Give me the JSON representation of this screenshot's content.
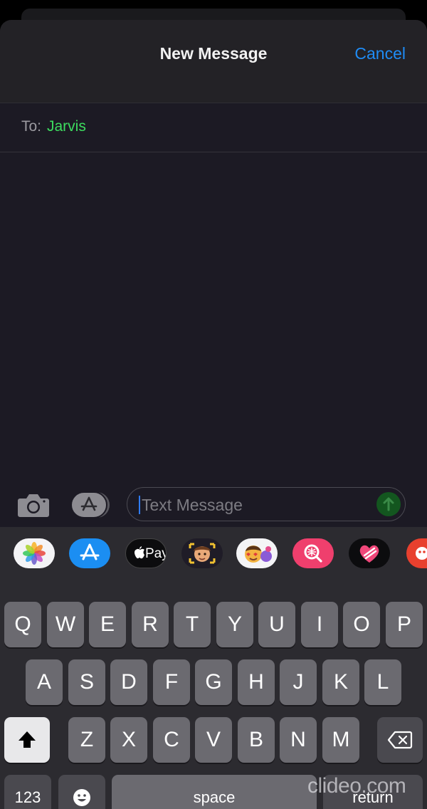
{
  "header": {
    "title": "New Message",
    "cancel_label": "Cancel"
  },
  "recipient": {
    "label": "To:",
    "name": "Jarvis"
  },
  "compose": {
    "placeholder": "Text Message",
    "value": ""
  },
  "app_strip": {
    "icons": [
      "photos-icon",
      "app-store-icon",
      "apple-pay-icon",
      "memoji-icon",
      "animoji-stickers-icon",
      "image-search-icon",
      "digital-touch-icon",
      "more-app-icon"
    ],
    "apple_pay_label": "Pay"
  },
  "keyboard": {
    "row1": [
      "Q",
      "W",
      "E",
      "R",
      "T",
      "Y",
      "U",
      "I",
      "O",
      "P"
    ],
    "row2": [
      "A",
      "S",
      "D",
      "F",
      "G",
      "H",
      "J",
      "K",
      "L"
    ],
    "row3": [
      "Z",
      "X",
      "C",
      "V",
      "B",
      "N",
      "M"
    ],
    "numbers_label": "123",
    "space_label": "space",
    "return_label": "return"
  },
  "watermark": "clideo.com",
  "colors": {
    "accent": "#1f8cf5",
    "recipient": "#3ddc5f",
    "send": "#13561f"
  }
}
